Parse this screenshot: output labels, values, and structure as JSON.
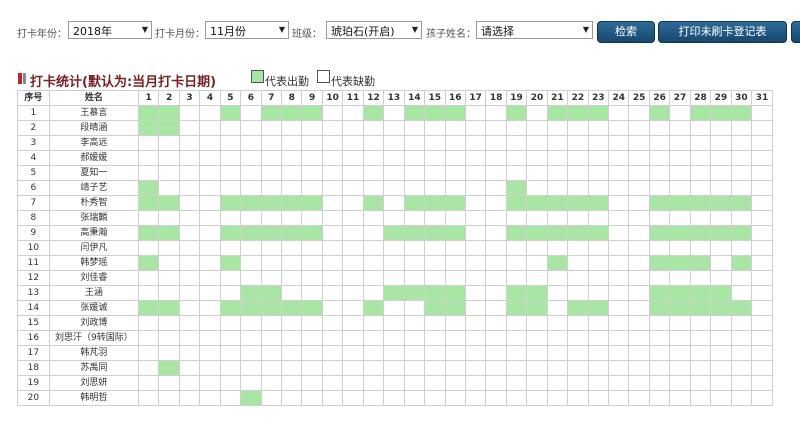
{
  "filters": {
    "year_label": "打卡年份：",
    "year_value": "2018年",
    "month_label": "打卡月份：",
    "month_value": "11月份",
    "class_label": "班级：",
    "class_value": "琥珀石(开启)",
    "child_label": "孩子姓名：",
    "child_value": "请选择"
  },
  "buttons": {
    "search": "检索",
    "print": "打印未刷卡登记表"
  },
  "section": {
    "title": "打卡统计(默认为:当月打卡日期)",
    "legend_present": "代表出勤",
    "legend_absent": "代表缺勤"
  },
  "colors": {
    "present": "#a8e6a3",
    "absent": "#ffffff",
    "button": "#1e5a87",
    "title": "#7a1f23"
  },
  "table": {
    "header_seq": "序号",
    "header_name": "姓名",
    "days": [
      "1",
      "2",
      "3",
      "4",
      "5",
      "6",
      "7",
      "8",
      "9",
      "10",
      "11",
      "12",
      "13",
      "14",
      "15",
      "16",
      "17",
      "18",
      "19",
      "20",
      "21",
      "22",
      "23",
      "24",
      "25",
      "26",
      "27",
      "28",
      "29",
      "30",
      "31"
    ],
    "rows": [
      {
        "seq": "1",
        "name": "王慕言",
        "present": [
          1,
          2,
          5,
          7,
          8,
          9,
          12,
          14,
          15,
          16,
          19,
          21,
          22,
          23,
          26,
          28,
          29,
          30
        ]
      },
      {
        "seq": "2",
        "name": "段晴涵",
        "present": [
          1,
          2
        ]
      },
      {
        "seq": "3",
        "name": "李高远",
        "present": []
      },
      {
        "seq": "4",
        "name": "郝媛媛",
        "present": []
      },
      {
        "seq": "5",
        "name": "夏知一",
        "present": []
      },
      {
        "seq": "6",
        "name": "靖子艺",
        "present": [
          1,
          19
        ]
      },
      {
        "seq": "7",
        "name": "朴秀智",
        "present": [
          1,
          2,
          5,
          6,
          7,
          8,
          9,
          12,
          14,
          15,
          16,
          19,
          20,
          21,
          22,
          23,
          26,
          27,
          28,
          29,
          30
        ]
      },
      {
        "seq": "8",
        "name": "张瑞麟",
        "present": []
      },
      {
        "seq": "9",
        "name": "高秉瀚",
        "present": [
          1,
          2,
          5,
          6,
          7,
          8,
          9,
          13,
          14,
          15,
          16,
          19,
          20,
          21,
          22,
          23,
          26,
          27,
          28,
          29,
          30
        ]
      },
      {
        "seq": "10",
        "name": "闫伊凡",
        "present": []
      },
      {
        "seq": "11",
        "name": "韩梦瑶",
        "present": [
          1,
          5,
          21,
          26,
          27,
          28,
          30
        ]
      },
      {
        "seq": "12",
        "name": "刘佳睿",
        "present": []
      },
      {
        "seq": "13",
        "name": "王涵",
        "present": [
          6,
          7,
          13,
          14,
          15,
          16,
          19,
          20,
          26,
          27,
          28,
          29
        ]
      },
      {
        "seq": "14",
        "name": "张媛诚",
        "present": [
          1,
          2,
          5,
          6,
          7,
          8,
          9,
          12,
          15,
          16,
          19,
          20,
          22,
          23,
          26,
          27,
          28,
          29,
          30
        ]
      },
      {
        "seq": "15",
        "name": "刘政博",
        "present": []
      },
      {
        "seq": "16",
        "name": "刘思汗（9转国际）",
        "present": []
      },
      {
        "seq": "17",
        "name": "韩芃羽",
        "present": []
      },
      {
        "seq": "18",
        "name": "苏禹同",
        "present": [
          2
        ]
      },
      {
        "seq": "19",
        "name": "刘思妍",
        "present": []
      },
      {
        "seq": "20",
        "name": "韩明哲",
        "present": [
          6
        ]
      }
    ]
  }
}
